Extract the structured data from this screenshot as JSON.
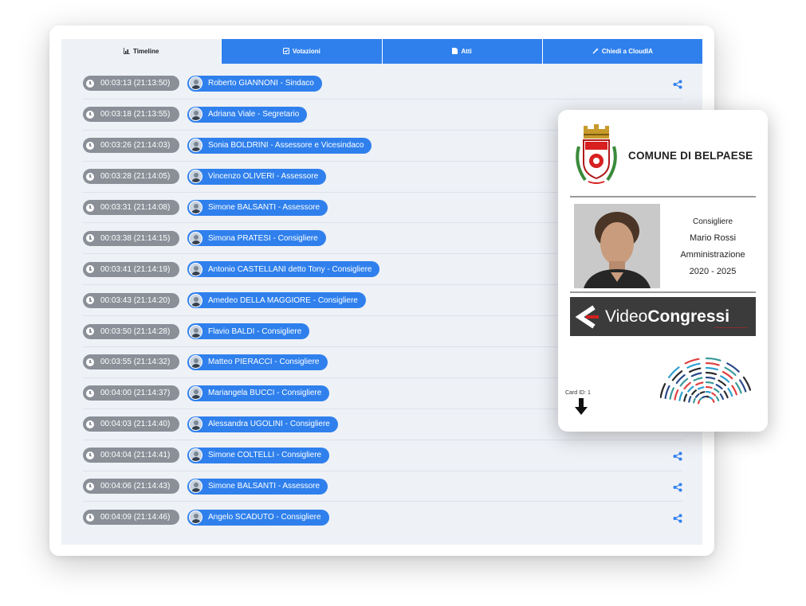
{
  "tabs": [
    {
      "label": "Timeline",
      "icon": "chart-icon",
      "active": true
    },
    {
      "label": "Votazioni",
      "icon": "vote-icon",
      "active": false
    },
    {
      "label": "Atti",
      "icon": "document-icon",
      "active": false
    },
    {
      "label": "Chiedi a CloudIA",
      "icon": "magic-wand-icon",
      "active": false
    }
  ],
  "timeline": [
    {
      "time": "00:03:13 (21:13:50)",
      "person": "Roberto GIANNONI - Sindaco"
    },
    {
      "time": "00:03:18 (21:13:55)",
      "person": "Adriana Viale - Segretario"
    },
    {
      "time": "00:03:26 (21:14:03)",
      "person": "Sonia BOLDRINI - Assessore e Vicesindaco"
    },
    {
      "time": "00:03:28 (21:14:05)",
      "person": "Vincenzo OLIVERI - Assessore"
    },
    {
      "time": "00:03:31 (21:14:08)",
      "person": "Simone BALSANTI - Assessore"
    },
    {
      "time": "00:03:38 (21:14:15)",
      "person": "Simona PRATESI - Consigliere"
    },
    {
      "time": "00:03:41 (21:14:19)",
      "person": "Antonio CASTELLANI detto Tony - Consigliere"
    },
    {
      "time": "00:03:43 (21:14:20)",
      "person": "Amedeo DELLA MAGGIORE - Consigliere"
    },
    {
      "time": "00:03:50 (21:14:28)",
      "person": "Flavio BALDI - Consigliere"
    },
    {
      "time": "00:03:55 (21:14:32)",
      "person": "Matteo PIERACCI - Consigliere"
    },
    {
      "time": "00:04:00 (21:14:37)",
      "person": "Mariangela BUCCI - Consigliere"
    },
    {
      "time": "00:04:03 (21:14:40)",
      "person": "Alessandra UGOLINI - Consigliere"
    },
    {
      "time": "00:04:04 (21:14:41)",
      "person": "Simone COLTELLI - Consigliere"
    },
    {
      "time": "00:04:06 (21:14:43)",
      "person": "Simone BALSANTI - Assessore"
    },
    {
      "time": "00:04:09 (21:14:46)",
      "person": "Angelo SCADUTO - Consigliere"
    }
  ],
  "id_card": {
    "comune": "COMUNE DI BELPAESE",
    "role": "Consigliere",
    "name": "Mario Rossi",
    "label": "Amministrazione",
    "period": "2020 - 2025",
    "logo_part1": "Video",
    "logo_part2": "Congressi",
    "card_id": "Card ID: 1"
  },
  "colors": {
    "accent": "#2f80ed",
    "time_pill": "#8a8f98",
    "panel_bg": "#eef1f6"
  }
}
